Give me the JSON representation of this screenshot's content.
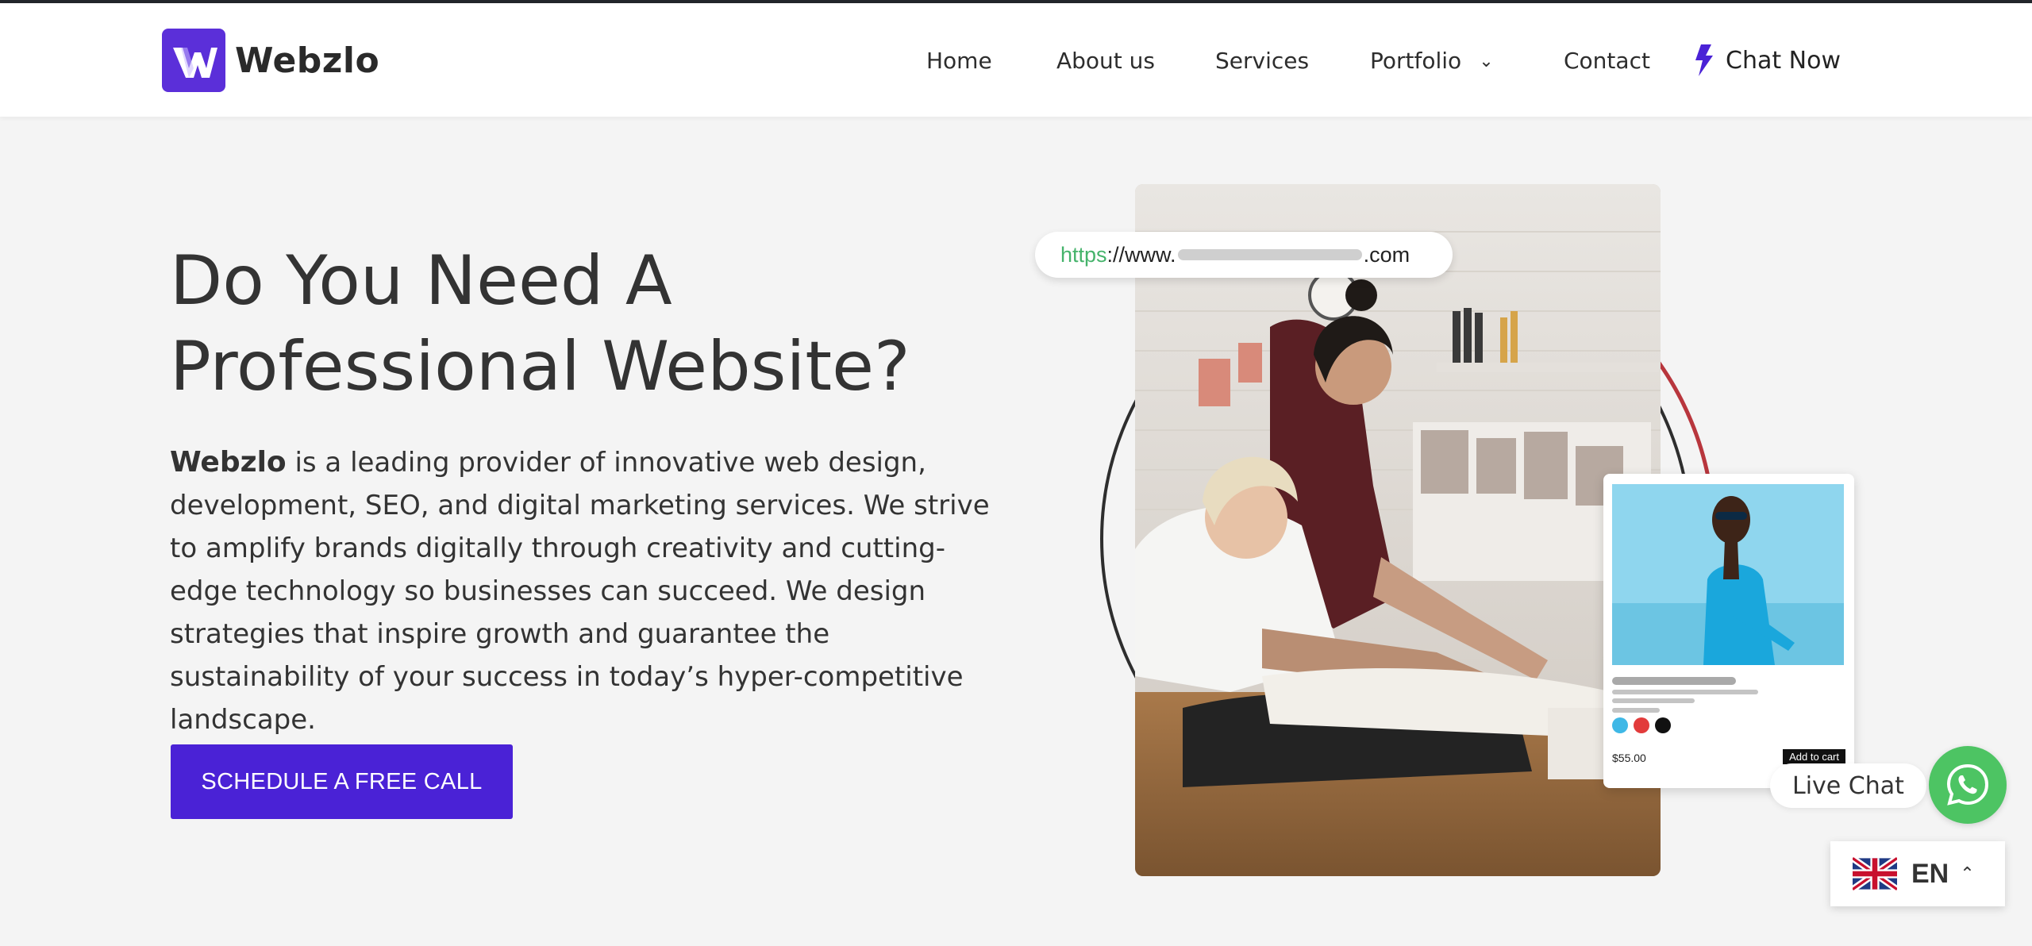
{
  "header": {
    "logo_text": "Webzlo",
    "nav": [
      {
        "label": "Home"
      },
      {
        "label": "About us"
      },
      {
        "label": "Services"
      },
      {
        "label": "Portfolio"
      },
      {
        "label": "Contact"
      }
    ],
    "chat_now": "Chat Now"
  },
  "hero": {
    "title": "Do You Need A\nProfessional Website?",
    "brand": "Webzlo",
    "description": "is  a leading provider of innovative web design, development, SEO, and digital marketing services. We strive to amplify brands digitally through creativity and cutting-edge technology so businesses can succeed. We design strategies that inspire growth and guarantee the sustainability of your  success in today’s hyper-competitive landscape.",
    "cta": "SCHEDULE A FREE CALL"
  },
  "art": {
    "url_scheme": "https",
    "url_prefix": "://www.",
    "url_suffix": ".com",
    "product_price": "$55.00",
    "add_to_cart": "Add to cart"
  },
  "widgets": {
    "live_chat": "Live Chat",
    "language": "EN"
  },
  "colors": {
    "brand_purple": "#4a22d6",
    "logo_purple": "#5b2fd9",
    "whatsapp_green": "#4dc463",
    "url_green": "#45b36b",
    "ring_red": "#b8363d",
    "ring_dark": "#2e2e2e"
  },
  "icons": {
    "portfolio_dropdown": "chevron-down-icon",
    "chat_now": "lightning-bolt-icon",
    "whatsapp": "whatsapp-icon",
    "language_flag": "uk-flag-icon",
    "language_toggle": "chevron-up-icon"
  }
}
